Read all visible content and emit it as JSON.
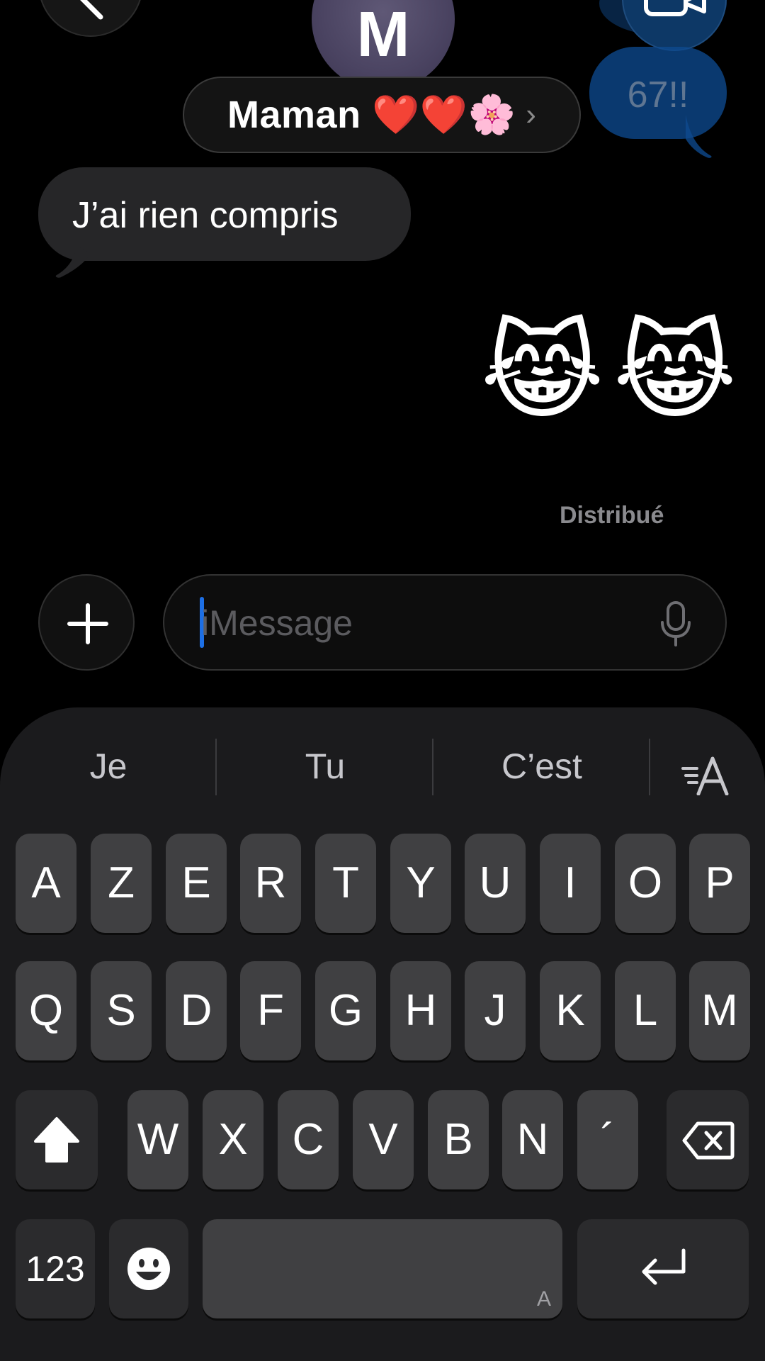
{
  "header": {
    "contact_initial": "M",
    "contact_name": "Maman ❤️❤️🌸",
    "chevron": "›"
  },
  "messages": {
    "outgoing_partial": "67!!",
    "incoming": "J’ai rien compris",
    "outgoing_emoji": "😹😹",
    "status": "Distribué"
  },
  "composer": {
    "placeholder": "iMessage"
  },
  "keyboard": {
    "suggestions": [
      "Je",
      "Tu",
      "C’est"
    ],
    "row1": [
      "A",
      "Z",
      "E",
      "R",
      "T",
      "Y",
      "U",
      "I",
      "O",
      "P"
    ],
    "row2": [
      "Q",
      "S",
      "D",
      "F",
      "G",
      "H",
      "J",
      "K",
      "L",
      "M"
    ],
    "row3": [
      "W",
      "X",
      "C",
      "V",
      "B",
      "N",
      "´"
    ],
    "numbers_key": "123",
    "space_hint": "A"
  },
  "colors": {
    "background": "#000000",
    "outgoing_bubble": "#0e4a8f",
    "incoming_bubble": "#262628",
    "caret": "#1d6fe5",
    "key": "#404042",
    "keyboard_bg": "#1b1b1d"
  },
  "icons": [
    "back-chevron-icon",
    "facetime-video-icon",
    "plus-icon",
    "microphone-icon",
    "text-format-icon",
    "shift-icon",
    "backspace-icon",
    "emoji-icon",
    "return-icon"
  ]
}
